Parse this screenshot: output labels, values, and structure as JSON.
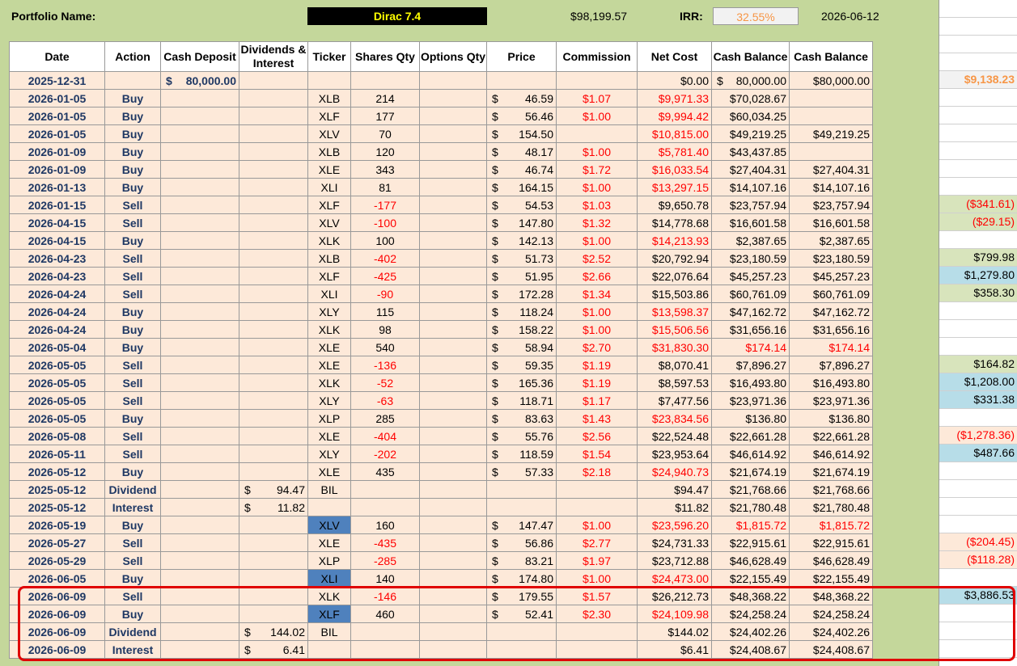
{
  "header": {
    "portfolio_label": "Portfolio Name:",
    "portfolio_name": "Dirac 7.4",
    "portfolio_value": "$98,199.57",
    "irr_label": "IRR:",
    "irr_value": "32.55%",
    "date": "2026-06-12"
  },
  "columns": [
    "Date",
    "Action",
    "Cash Deposit",
    "Dividends & Interest",
    "Ticker",
    "Shares Qty",
    "Options Qty",
    "Price",
    "Commission",
    "Net Cost",
    "Cash Balance",
    "Cash Balance"
  ],
  "rows": [
    {
      "date": "2025-12-31",
      "action": "",
      "deposit": "80,000.00",
      "div": "",
      "ticker": "",
      "shares": "",
      "options": "",
      "price": "",
      "comm": "",
      "net": "$0.00",
      "bal1": "80,000.00",
      "bal2": "$80,000.00",
      "right": "$9,138.23"
    },
    {
      "date": "2026-01-05",
      "action": "Buy",
      "deposit": "",
      "div": "",
      "ticker": "XLB",
      "shares": "214",
      "options": "",
      "price": "46.59",
      "comm": "$1.07",
      "net": "$9,971.33",
      "bal1": "$70,028.67",
      "bal2": "",
      "right": ""
    },
    {
      "date": "2026-01-05",
      "action": "Buy",
      "deposit": "",
      "div": "",
      "ticker": "XLF",
      "shares": "177",
      "options": "",
      "price": "56.46",
      "comm": "$1.00",
      "net": "$9,994.42",
      "bal1": "$60,034.25",
      "bal2": "",
      "right": ""
    },
    {
      "date": "2026-01-05",
      "action": "Buy",
      "deposit": "",
      "div": "",
      "ticker": "XLV",
      "shares": "70",
      "options": "",
      "price": "154.50",
      "comm": "",
      "net": "$10,815.00",
      "bal1": "$49,219.25",
      "bal2": "$49,219.25",
      "right": ""
    },
    {
      "date": "2026-01-09",
      "action": "Buy",
      "deposit": "",
      "div": "",
      "ticker": "XLB",
      "shares": "120",
      "options": "",
      "price": "48.17",
      "comm": "$1.00",
      "net": "$5,781.40",
      "bal1": "$43,437.85",
      "bal2": "",
      "right": ""
    },
    {
      "date": "2026-01-09",
      "action": "Buy",
      "deposit": "",
      "div": "",
      "ticker": "XLE",
      "shares": "343",
      "options": "",
      "price": "46.74",
      "comm": "$1.72",
      "net": "$16,033.54",
      "bal1": "$27,404.31",
      "bal2": "$27,404.31",
      "right": ""
    },
    {
      "date": "2026-01-13",
      "action": "Buy",
      "deposit": "",
      "div": "",
      "ticker": "XLI",
      "shares": "81",
      "options": "",
      "price": "164.15",
      "comm": "$1.00",
      "net": "$13,297.15",
      "bal1": "$14,107.16",
      "bal2": "$14,107.16",
      "right": ""
    },
    {
      "date": "2026-01-15",
      "action": "Sell",
      "deposit": "",
      "div": "",
      "ticker": "XLF",
      "shares": "-177",
      "options": "",
      "price": "54.53",
      "comm": "$1.03",
      "net": "$9,650.78",
      "bal1": "$23,757.94",
      "bal2": "$23,757.94",
      "right": "($341.61)"
    },
    {
      "date": "2026-04-15",
      "action": "Sell",
      "deposit": "",
      "div": "",
      "ticker": "XLV",
      "shares": "-100",
      "options": "",
      "price": "147.80",
      "comm": "$1.32",
      "net": "$14,778.68",
      "bal1": "$16,601.58",
      "bal2": "$16,601.58",
      "right": "($29.15)"
    },
    {
      "date": "2026-04-15",
      "action": "Buy",
      "deposit": "",
      "div": "",
      "ticker": "XLK",
      "shares": "100",
      "options": "",
      "price": "142.13",
      "comm": "$1.00",
      "net": "$14,213.93",
      "bal1": "$2,387.65",
      "bal2": "$2,387.65",
      "right": ""
    },
    {
      "date": "2026-04-23",
      "action": "Sell",
      "deposit": "",
      "div": "",
      "ticker": "XLB",
      "shares": "-402",
      "options": "",
      "price": "51.73",
      "comm": "$2.52",
      "net": "$20,792.94",
      "bal1": "$23,180.59",
      "bal2": "$23,180.59",
      "right": "$799.98"
    },
    {
      "date": "2026-04-23",
      "action": "Sell",
      "deposit": "",
      "div": "",
      "ticker": "XLF",
      "shares": "-425",
      "options": "",
      "price": "51.95",
      "comm": "$2.66",
      "net": "$22,076.64",
      "bal1": "$45,257.23",
      "bal2": "$45,257.23",
      "right": "$1,279.80"
    },
    {
      "date": "2026-04-24",
      "action": "Sell",
      "deposit": "",
      "div": "",
      "ticker": "XLI",
      "shares": "-90",
      "options": "",
      "price": "172.28",
      "comm": "$1.34",
      "net": "$15,503.86",
      "bal1": "$60,761.09",
      "bal2": "$60,761.09",
      "right": "$358.30"
    },
    {
      "date": "2026-04-24",
      "action": "Buy",
      "deposit": "",
      "div": "",
      "ticker": "XLY",
      "shares": "115",
      "options": "",
      "price": "118.24",
      "comm": "$1.00",
      "net": "$13,598.37",
      "bal1": "$47,162.72",
      "bal2": "$47,162.72",
      "right": ""
    },
    {
      "date": "2026-04-24",
      "action": "Buy",
      "deposit": "",
      "div": "",
      "ticker": "XLK",
      "shares": "98",
      "options": "",
      "price": "158.22",
      "comm": "$1.00",
      "net": "$15,506.56",
      "bal1": "$31,656.16",
      "bal2": "$31,656.16",
      "right": ""
    },
    {
      "date": "2026-05-04",
      "action": "Buy",
      "deposit": "",
      "div": "",
      "ticker": "XLE",
      "shares": "540",
      "options": "",
      "price": "58.94",
      "comm": "$2.70",
      "net": "$31,830.30",
      "bal1": "$174.14",
      "bal2": "$174.14",
      "right": ""
    },
    {
      "date": "2026-05-05",
      "action": "Sell",
      "deposit": "",
      "div": "",
      "ticker": "XLE",
      "shares": "-136",
      "options": "",
      "price": "59.35",
      "comm": "$1.19",
      "net": "$8,070.41",
      "bal1": "$7,896.27",
      "bal2": "$7,896.27",
      "right": "$164.82"
    },
    {
      "date": "2026-05-05",
      "action": "Sell",
      "deposit": "",
      "div": "",
      "ticker": "XLK",
      "shares": "-52",
      "options": "",
      "price": "165.36",
      "comm": "$1.19",
      "net": "$8,597.53",
      "bal1": "$16,493.80",
      "bal2": "$16,493.80",
      "right": "$1,208.00"
    },
    {
      "date": "2026-05-05",
      "action": "Sell",
      "deposit": "",
      "div": "",
      "ticker": "XLY",
      "shares": "-63",
      "options": "",
      "price": "118.71",
      "comm": "$1.17",
      "net": "$7,477.56",
      "bal1": "$23,971.36",
      "bal2": "$23,971.36",
      "right": "$331.38"
    },
    {
      "date": "2026-05-05",
      "action": "Buy",
      "deposit": "",
      "div": "",
      "ticker": "XLP",
      "shares": "285",
      "options": "",
      "price": "83.63",
      "comm": "$1.43",
      "net": "$23,834.56",
      "bal1": "$136.80",
      "bal2": "$136.80",
      "right": ""
    },
    {
      "date": "2026-05-08",
      "action": "Sell",
      "deposit": "",
      "div": "",
      "ticker": "XLE",
      "shares": "-404",
      "options": "",
      "price": "55.76",
      "comm": "$2.56",
      "net": "$22,524.48",
      "bal1": "$22,661.28",
      "bal2": "$22,661.28",
      "right": "($1,278.36)"
    },
    {
      "date": "2026-05-11",
      "action": "Sell",
      "deposit": "",
      "div": "",
      "ticker": "XLY",
      "shares": "-202",
      "options": "",
      "price": "118.59",
      "comm": "$1.54",
      "net": "$23,953.64",
      "bal1": "$46,614.92",
      "bal2": "$46,614.92",
      "right": "$487.66"
    },
    {
      "date": "2026-05-12",
      "action": "Buy",
      "deposit": "",
      "div": "",
      "ticker": "XLE",
      "shares": "435",
      "options": "",
      "price": "57.33",
      "comm": "$2.18",
      "net": "$24,940.73",
      "bal1": "$21,674.19",
      "bal2": "$21,674.19",
      "right": ""
    },
    {
      "date": "2025-05-12",
      "action": "Dividend",
      "deposit": "",
      "div": "94.47",
      "ticker": "BIL",
      "shares": "",
      "options": "",
      "price": "",
      "comm": "",
      "net": "$94.47",
      "bal1": "$21,768.66",
      "bal2": "$21,768.66",
      "right": ""
    },
    {
      "date": "2025-05-12",
      "action": "Interest",
      "deposit": "",
      "div": "11.82",
      "ticker": "",
      "shares": "",
      "options": "",
      "price": "",
      "comm": "",
      "net": "$11.82",
      "bal1": "$21,780.48",
      "bal2": "$21,780.48",
      "right": ""
    },
    {
      "date": "2026-05-19",
      "action": "Buy",
      "deposit": "",
      "div": "",
      "ticker": "XLV",
      "shares": "160",
      "options": "",
      "price": "147.47",
      "comm": "$1.00",
      "net": "$23,596.20",
      "bal1": "$1,815.72",
      "bal2": "$1,815.72",
      "right": ""
    },
    {
      "date": "2026-05-27",
      "action": "Sell",
      "deposit": "",
      "div": "",
      "ticker": "XLE",
      "shares": "-435",
      "options": "",
      "price": "56.86",
      "comm": "$2.77",
      "net": "$24,731.33",
      "bal1": "$22,915.61",
      "bal2": "$22,915.61",
      "right": "($204.45)"
    },
    {
      "date": "2026-05-29",
      "action": "Sell",
      "deposit": "",
      "div": "",
      "ticker": "XLP",
      "shares": "-285",
      "options": "",
      "price": "83.21",
      "comm": "$1.97",
      "net": "$23,712.88",
      "bal1": "$46,628.49",
      "bal2": "$46,628.49",
      "right": "($118.28)"
    },
    {
      "date": "2026-06-05",
      "action": "Buy",
      "deposit": "",
      "div": "",
      "ticker": "XLI",
      "shares": "140",
      "options": "",
      "price": "174.80",
      "comm": "$1.00",
      "net": "$24,473.00",
      "bal1": "$22,155.49",
      "bal2": "$22,155.49",
      "right": ""
    },
    {
      "date": "2026-06-09",
      "action": "Sell",
      "deposit": "",
      "div": "",
      "ticker": "XLK",
      "shares": "-146",
      "options": "",
      "price": "179.55",
      "comm": "$1.57",
      "net": "$26,212.73",
      "bal1": "$48,368.22",
      "bal2": "$48,368.22",
      "right": "$3,886.53"
    },
    {
      "date": "2026-06-09",
      "action": "Buy",
      "deposit": "",
      "div": "",
      "ticker": "XLF",
      "shares": "460",
      "options": "",
      "price": "52.41",
      "comm": "$2.30",
      "net": "$24,109.98",
      "bal1": "$24,258.24",
      "bal2": "$24,258.24",
      "right": ""
    },
    {
      "date": "2026-06-09",
      "action": "Dividend",
      "deposit": "",
      "div": "144.02",
      "ticker": "BIL",
      "shares": "",
      "options": "",
      "price": "",
      "comm": "",
      "net": "$144.02",
      "bal1": "$24,402.26",
      "bal2": "$24,402.26",
      "right": ""
    },
    {
      "date": "2026-06-09",
      "action": "Interest",
      "deposit": "",
      "div": "6.41",
      "ticker": "",
      "shares": "",
      "options": "",
      "price": "",
      "comm": "",
      "net": "$6.41",
      "bal1": "$24,408.67",
      "bal2": "$24,408.67",
      "right": ""
    }
  ],
  "currency_symbol": "$",
  "colors": {
    "background": "#c4d79b",
    "row_fill": "#fde9d9",
    "negative": "#ff0000",
    "date_text": "#1f3864",
    "ticker_highlight": "#4f81bd",
    "gain_green": "#d8e4bc",
    "gain_blue": "#b7dde8",
    "loss_orange": "#fde9d9",
    "highlight_box": "#e00000"
  }
}
